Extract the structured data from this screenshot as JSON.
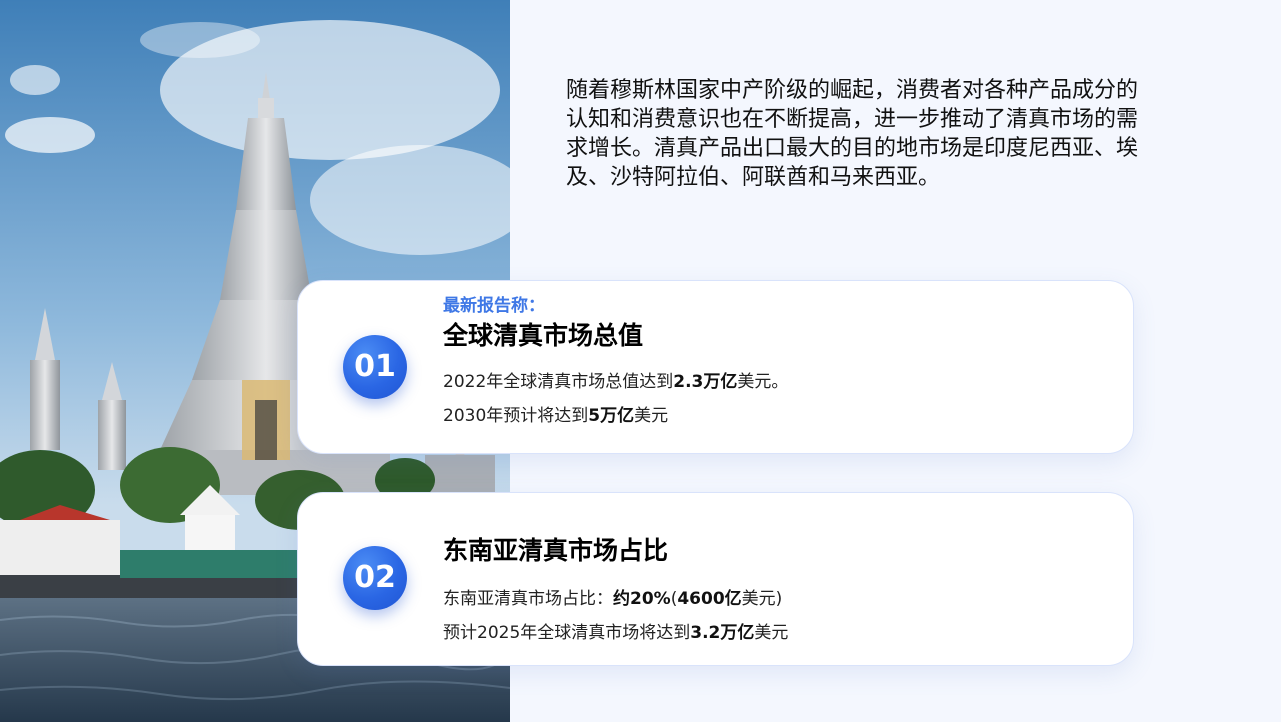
{
  "intro_text": "随着穆斯林国家中产阶级的崛起，消费者对各种产品成分的认知和消费意识也在不断提高，进一步推动了清真市场的需求增长。清真产品出口最大的目的地市场是印度尼西亚、埃及、沙特阿拉伯、阿联酋和马来西亚。",
  "photo": {
    "subject": "temple-by-river-photo"
  },
  "cards": [
    {
      "number": "01",
      "kicker": "最新报告称：",
      "title": "全球清真市场总值",
      "line1": {
        "pre": "2022年全球清真市场总值达到",
        "bold": "2.3万亿",
        "post": "美元。"
      },
      "line2": {
        "pre": "2030年预计将达到",
        "bold": "5万亿",
        "post": "美元"
      }
    },
    {
      "number": "02",
      "title": "东南亚清真市场占比",
      "line1": {
        "pre": "东南亚清真市场占比：",
        "bold": "约20%",
        "mid": "(",
        "bold2": "4600亿",
        "post": "美元)"
      },
      "line2": {
        "pre": "预计2025年全球清真市场将达到",
        "bold": "3.2万亿",
        "post": "美元"
      }
    }
  ],
  "colors": {
    "accent": "#2a66e4",
    "kicker": "#3f78e6",
    "background": "#f4f7fe"
  }
}
